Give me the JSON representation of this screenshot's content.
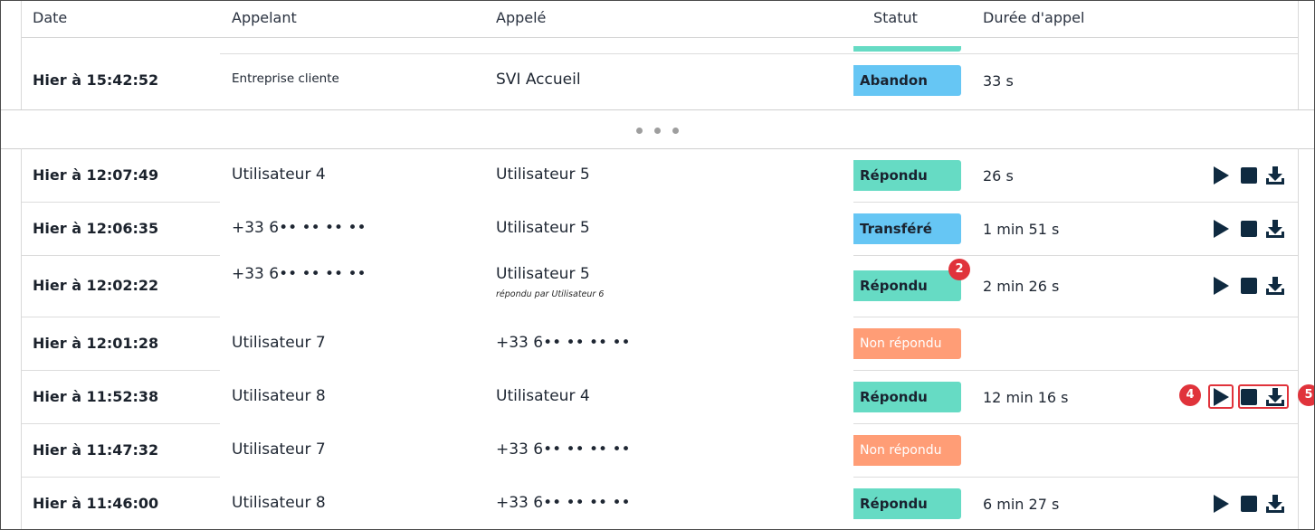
{
  "headers": {
    "date": "Date",
    "caller": "Appelant",
    "callee": "Appelé",
    "status": "Statut",
    "duration": "Durée d'appel"
  },
  "pagination": {
    "dots": "• • •"
  },
  "top_row": {
    "date": "Hier à 15:42:52",
    "caller": "Entreprise cliente",
    "callee": "SVI Accueil",
    "status": "Abandon",
    "duration": "33 s"
  },
  "rows": [
    {
      "date": "Hier à 12:07:49",
      "caller": "Utilisateur 4",
      "callee": "Utilisateur 5",
      "callee_note": "",
      "status": "Répondu",
      "duration": "26 s"
    },
    {
      "date": "Hier à 12:06:35",
      "caller": "+33 6•• •• •• ••",
      "callee": "Utilisateur 5",
      "callee_note": "",
      "status": "Transféré",
      "duration": "1 min 51 s"
    },
    {
      "date": "Hier à 12:02:22",
      "caller": "+33 6•• •• •• ••",
      "callee": "Utilisateur 5",
      "callee_note": "répondu par Utilisateur 6",
      "status": "Répondu",
      "duration": "2 min 26 s"
    },
    {
      "date": "Hier à 12:01:28",
      "caller": "Utilisateur 7",
      "callee": "+33 6•• •• •• ••",
      "callee_note": "",
      "status": "Non répondu",
      "duration": ""
    },
    {
      "date": "Hier à 11:52:38",
      "caller": "Utilisateur 8",
      "callee": "Utilisateur 4",
      "callee_note": "",
      "status": "Répondu",
      "duration": "12 min 16 s"
    },
    {
      "date": "Hier à 11:47:32",
      "caller": "Utilisateur 7",
      "callee": "+33 6•• •• •• ••",
      "callee_note": "",
      "status": "Non répondu",
      "duration": ""
    },
    {
      "date": "Hier à 11:46:00",
      "caller": "Utilisateur 8",
      "callee": "+33 6•• •• •• ••",
      "callee_note": "",
      "status": "Répondu",
      "duration": "6 min 27 s"
    }
  ],
  "markers": {
    "m2": "2",
    "m4": "4",
    "m5": "5"
  },
  "colors": {
    "answered": "#66dbc4",
    "transferred": "#66c6f4",
    "abandoned": "#66c6f4",
    "missed": "#ff9d76",
    "icon": "#0f2a40",
    "marker": "#e0333b"
  },
  "icons": {
    "play": "play-icon",
    "stop": "stop-icon",
    "download": "download-icon"
  }
}
